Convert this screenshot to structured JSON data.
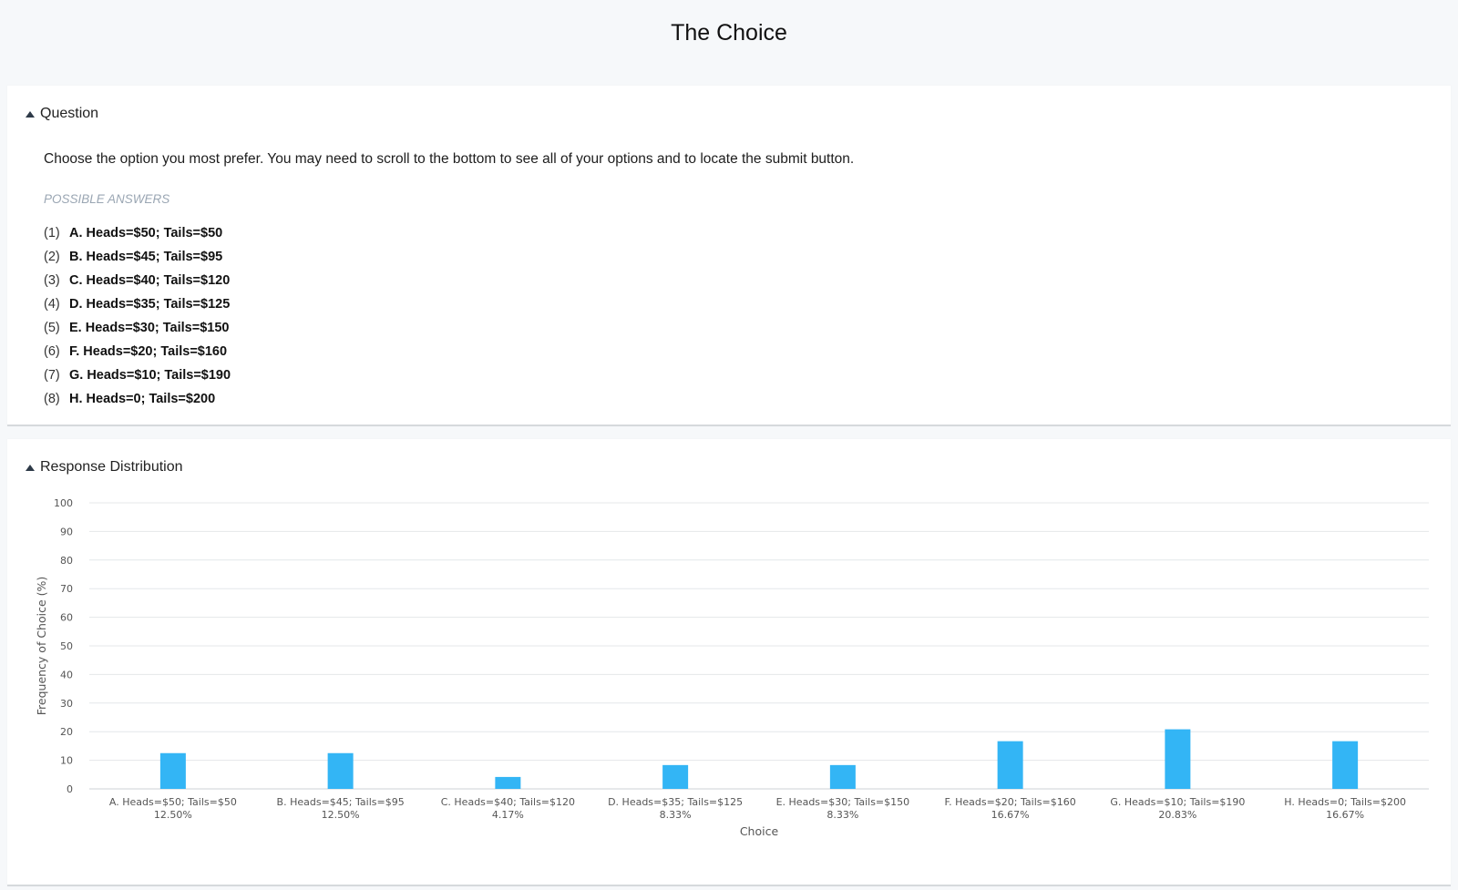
{
  "page": {
    "title": "The Choice"
  },
  "question_section": {
    "header": "Question",
    "text": "Choose the option you most prefer. You may need to scroll to the bottom to see all of your options and to locate the submit button.",
    "answers_label": "POSSIBLE ANSWERS",
    "answers": [
      {
        "num": "(1)",
        "label": "A. Heads=$50; Tails=$50"
      },
      {
        "num": "(2)",
        "label": "B. Heads=$45; Tails=$95"
      },
      {
        "num": "(3)",
        "label": "C. Heads=$40; Tails=$120"
      },
      {
        "num": "(4)",
        "label": "D. Heads=$35; Tails=$125"
      },
      {
        "num": "(5)",
        "label": "E. Heads=$30; Tails=$150"
      },
      {
        "num": "(6)",
        "label": "F. Heads=$20; Tails=$160"
      },
      {
        "num": "(7)",
        "label": "G. Heads=$10; Tails=$190"
      },
      {
        "num": "(8)",
        "label": "H. Heads=0; Tails=$200"
      }
    ]
  },
  "distribution_section": {
    "header": "Response Distribution"
  },
  "colors": {
    "bar": "#33b5f5",
    "grid": "#e4e7ea",
    "axis": "#cdd1d5"
  },
  "icons": {
    "section_toggle": "caret-up-icon"
  },
  "chart_data": {
    "type": "bar",
    "categories": [
      "A. Heads=$50; Tails=$50",
      "B. Heads=$45; Tails=$95",
      "C. Heads=$40; Tails=$120",
      "D. Heads=$35; Tails=$125",
      "E. Heads=$30; Tails=$150",
      "F. Heads=$20; Tails=$160",
      "G. Heads=$10; Tails=$190",
      "H. Heads=0; Tails=$200"
    ],
    "values": [
      12.5,
      12.5,
      4.17,
      8.33,
      8.33,
      16.67,
      20.83,
      16.67
    ],
    "value_labels": [
      "12.50%",
      "12.50%",
      "4.17%",
      "8.33%",
      "8.33%",
      "16.67%",
      "20.83%",
      "16.67%"
    ],
    "xlabel": "Choice",
    "ylabel": "Frequency of Choice (%)",
    "ylim": [
      0,
      100
    ],
    "yticks": [
      0,
      10,
      20,
      30,
      40,
      50,
      60,
      70,
      80,
      90,
      100
    ],
    "grid": true
  }
}
